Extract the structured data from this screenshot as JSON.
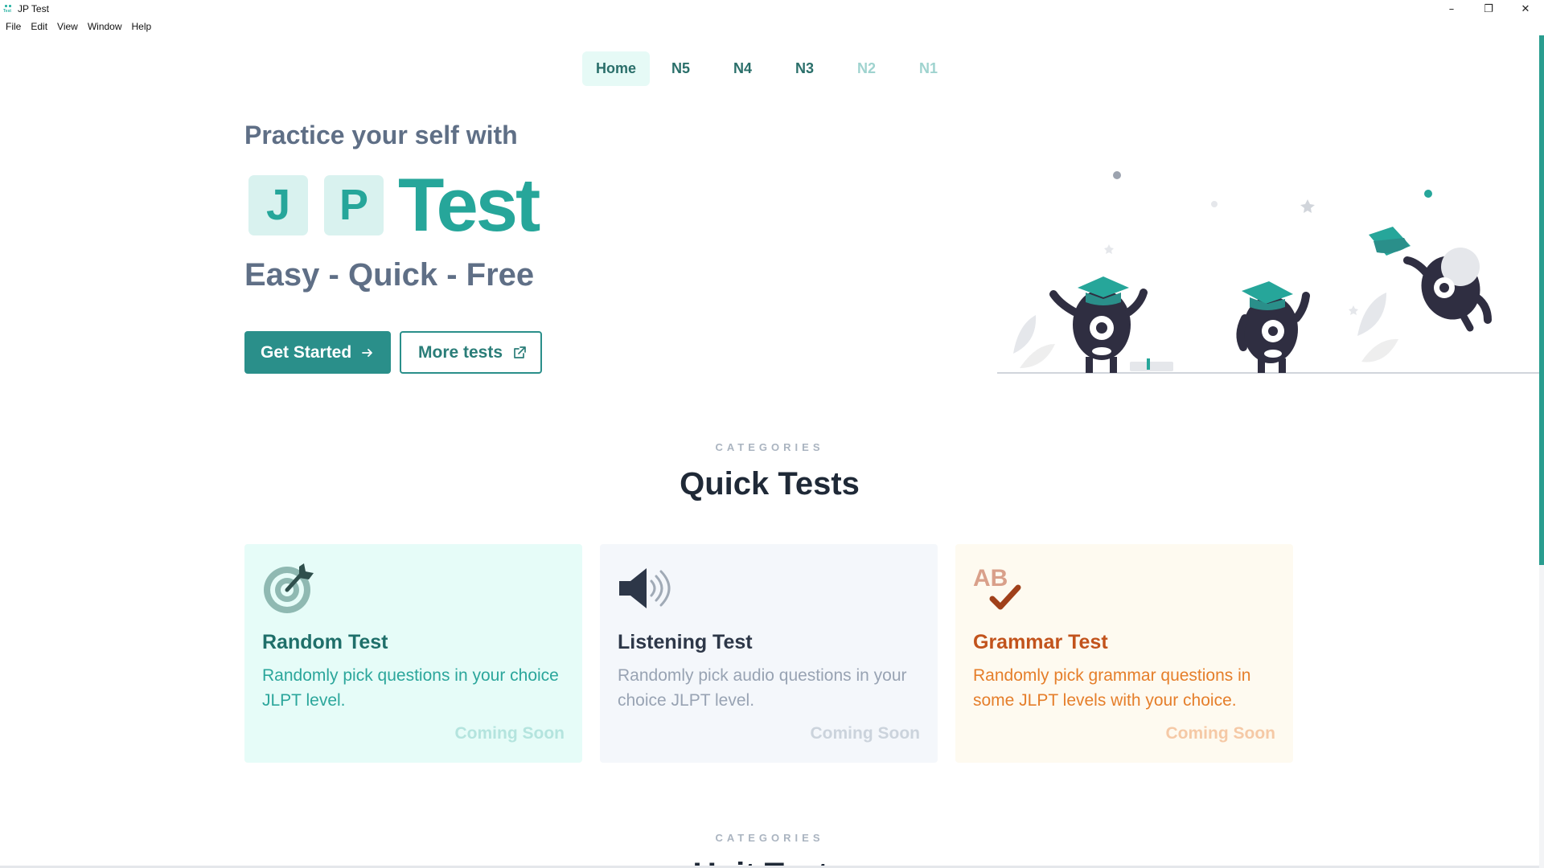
{
  "window": {
    "title": "JP Test",
    "controls": {
      "minimize": "–",
      "restore": "❐",
      "close": "✕"
    }
  },
  "menu": [
    "File",
    "Edit",
    "View",
    "Window",
    "Help"
  ],
  "nav": {
    "tabs": [
      {
        "label": "Home",
        "state": "active"
      },
      {
        "label": "N5",
        "state": "enabled"
      },
      {
        "label": "N4",
        "state": "enabled"
      },
      {
        "label": "N3",
        "state": "enabled"
      },
      {
        "label": "N2",
        "state": "disabled"
      },
      {
        "label": "N1",
        "state": "disabled"
      }
    ]
  },
  "hero": {
    "kicker": "Practice your self with",
    "logo_letters": [
      "J",
      "P"
    ],
    "logo_word": "Test",
    "tagline": "Easy - Quick - Free",
    "primary_button": "Get Started",
    "primary_icon": "arrow-right-icon",
    "secondary_button": "More tests",
    "secondary_icon": "external-link-icon"
  },
  "quick_tests": {
    "kicker": "CATEGORIES",
    "title": "Quick Tests",
    "cards": [
      {
        "theme": "teal",
        "icon": "target-icon",
        "title": "Random Test",
        "description": "Randomly pick questions in your choice JLPT level.",
        "status": "Coming Soon"
      },
      {
        "theme": "slate",
        "icon": "speaker-icon",
        "title": "Listening Test",
        "description": "Randomly pick audio questions in your choice JLPT level.",
        "status": "Coming Soon"
      },
      {
        "theme": "amber",
        "icon": "grammar-check-icon",
        "title": "Grammar Test",
        "description": "Randomly pick grammar questions in some JLPT levels with your choice.",
        "status": "Coming Soon"
      }
    ]
  },
  "unit_tests": {
    "kicker": "CATEGORIES",
    "title": "Unit Tests"
  },
  "colors": {
    "accent": "#26a69a",
    "primary_button": "#2a8f8a",
    "text_muted": "#5f6f86",
    "illustration_dark": "#2f2e41"
  }
}
